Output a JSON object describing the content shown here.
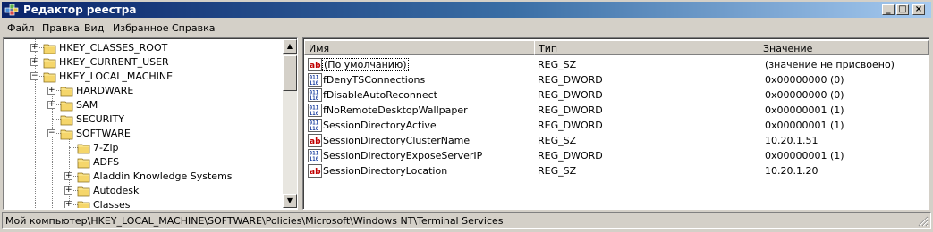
{
  "window": {
    "title": "Редактор реестра"
  },
  "titlebar_buttons": {
    "minimize": "_",
    "maximize": "□",
    "close": "×"
  },
  "menu": [
    {
      "label": "Файл"
    },
    {
      "label": "Правка"
    },
    {
      "label": "Вид"
    },
    {
      "label": "Избранное"
    },
    {
      "label": "Справка"
    }
  ],
  "tree": [
    {
      "label": "HKEY_CLASSES_ROOT",
      "expander": "+"
    },
    {
      "label": "HKEY_CURRENT_USER",
      "expander": "+"
    },
    {
      "label": "HKEY_LOCAL_MACHINE",
      "expander": "−"
    },
    {
      "label": "HARDWARE",
      "expander": "+"
    },
    {
      "label": "SAM",
      "expander": "+"
    },
    {
      "label": "SECURITY",
      "expander": ""
    },
    {
      "label": "SOFTWARE",
      "expander": "−"
    },
    {
      "label": "7-Zip",
      "expander": ""
    },
    {
      "label": "ADFS",
      "expander": ""
    },
    {
      "label": "Aladdin Knowledge Systems",
      "expander": "+"
    },
    {
      "label": "Autodesk",
      "expander": "+"
    },
    {
      "label": "Classes",
      "expander": "+"
    }
  ],
  "columns": {
    "name": "Имя",
    "type": "Тип",
    "value": "Значение"
  },
  "values": [
    {
      "name": "(По умолчанию)",
      "type": "REG_SZ",
      "data": "(значение не присвоено)",
      "icon": "string-value-icon"
    },
    {
      "name": "fDenyTSConnections",
      "type": "REG_DWORD",
      "data": "0x00000000 (0)",
      "icon": "binary-value-icon"
    },
    {
      "name": "fDisableAutoReconnect",
      "type": "REG_DWORD",
      "data": "0x00000000 (0)",
      "icon": "binary-value-icon"
    },
    {
      "name": "fNoRemoteDesktopWallpaper",
      "type": "REG_DWORD",
      "data": "0x00000001 (1)",
      "icon": "binary-value-icon"
    },
    {
      "name": "SessionDirectoryActive",
      "type": "REG_DWORD",
      "data": "0x00000001 (1)",
      "icon": "binary-value-icon"
    },
    {
      "name": "SessionDirectoryClusterName",
      "type": "REG_SZ",
      "data": "10.20.1.51",
      "icon": "string-value-icon"
    },
    {
      "name": "SessionDirectoryExposeServerIP",
      "type": "REG_DWORD",
      "data": "0x00000001 (1)",
      "icon": "binary-value-icon"
    },
    {
      "name": "SessionDirectoryLocation",
      "type": "REG_SZ",
      "data": "10.20.1.20",
      "icon": "string-value-icon"
    }
  ],
  "status": {
    "path": "Мой компьютер\\HKEY_LOCAL_MACHINE\\SOFTWARE\\Policies\\Microsoft\\Windows NT\\Terminal Services"
  }
}
